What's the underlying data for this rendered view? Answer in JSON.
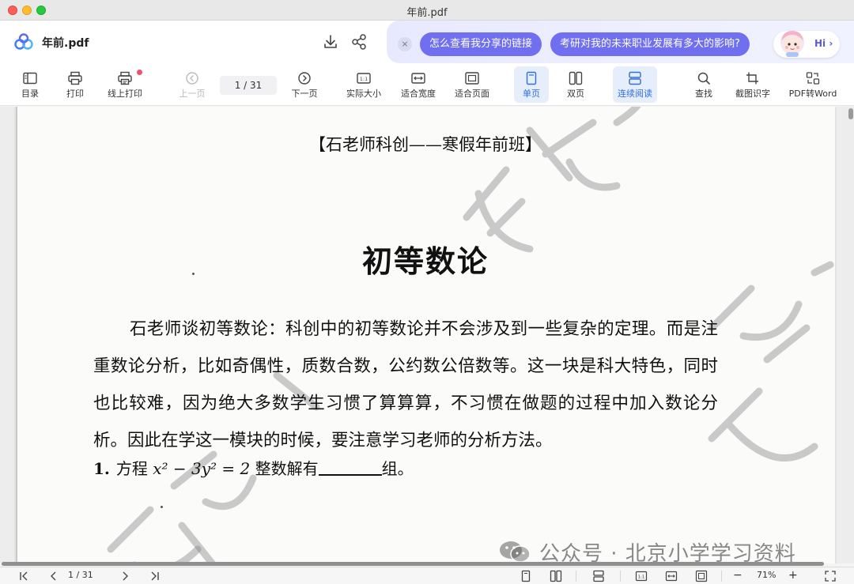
{
  "window": {
    "title": "年前.pdf"
  },
  "header": {
    "file_name": "年前.pdf",
    "download_icon": "download-icon",
    "share_icon": "share-icon"
  },
  "assistant": {
    "close_glyph": "×",
    "suggestions": [
      "怎么查看我分享的链接",
      "考研对我的未来职业发展有多大的影响?"
    ],
    "hi_label": "Hi ›",
    "avatar_icon": "assistant-avatar-icon"
  },
  "toolbar": {
    "catalog": "目录",
    "print": "打印",
    "online_print": "线上打印",
    "prev_page": "上一页",
    "page_indicator": "1  /  31",
    "next_page": "下一页",
    "actual_size": "实际大小",
    "fit_width": "适合宽度",
    "fit_page": "适合页面",
    "single_page": "单页",
    "double_page": "双页",
    "continuous": "连续阅读",
    "find": "查找",
    "ocr": "截图识字",
    "pdf_to_word": "PDF转Word"
  },
  "document": {
    "header": "【石老师科创——寒假年前班】",
    "title": "初等数论",
    "paragraph": "石老师谈初等数论：科创中的初等数论并不会涉及到一些复杂的定理。而是注重数论分析，比如奇偶性，质数合数，公约数公倍数等。这一块是科大特色，同时也比较难，因为绝大多数学生习惯了算算算，不习惯在做题的过程中加入数论分析。因此在学这一模块的时候，要注意学习老师的分析方法。",
    "problem_number": "1.",
    "problem_prefix": "方程",
    "problem_equation": "x² − 3y² = 2",
    "problem_middle": "整数解有",
    "problem_suffix": "组。",
    "watermark": "石老师"
  },
  "wechat_watermark": "公众号 · 北京小学学习资料",
  "bottombar": {
    "page_indicator": "1  /  31",
    "zoom": "71%",
    "zoom_out": "−",
    "zoom_in": "+"
  },
  "colors": {
    "accent": "#2f6ee0",
    "chip": "#6f6ff0",
    "active_bg": "#e6eefc",
    "notification": "#f0506e"
  }
}
